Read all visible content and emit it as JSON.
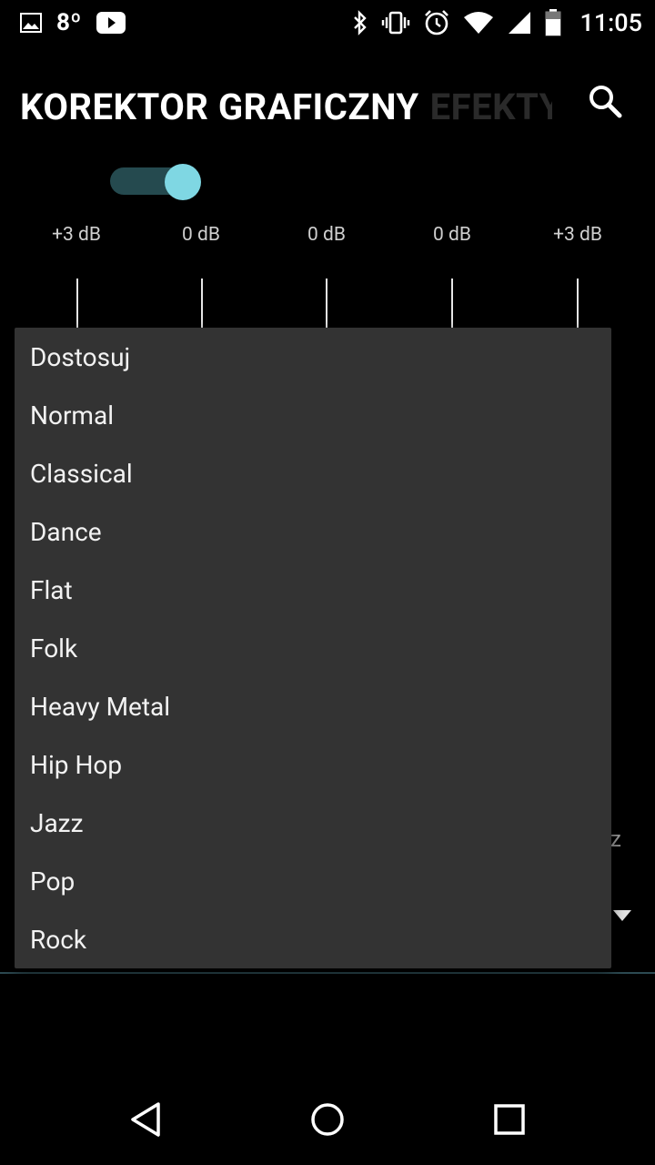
{
  "status_bar": {
    "temperature": "8º",
    "time": "11:05",
    "icons": [
      "image-icon",
      "youtube-icon",
      "bluetooth-icon",
      "vibrate-icon",
      "alarm-icon",
      "wifi-icon",
      "signal-icon",
      "battery-icon"
    ]
  },
  "header": {
    "tab_active": "KOREKTOR GRAFICZNY",
    "tab_inactive": "EFEKTY",
    "search_icon": "search-icon"
  },
  "toggle": {
    "state": "on",
    "accent": "#7fd7e3"
  },
  "eq": {
    "bands": [
      "+3 dB",
      "0 dB",
      "0 dB",
      "0 dB",
      "+3 dB"
    ]
  },
  "background_peek": {
    "partial_text": "z"
  },
  "dropdown": {
    "items": [
      "Dostosuj",
      "Normal",
      "Classical",
      "Dance",
      "Flat",
      "Folk",
      "Heavy Metal",
      "Hip Hop",
      "Jazz",
      "Pop",
      "Rock"
    ]
  },
  "nav": {
    "icons": [
      "back-icon",
      "home-icon",
      "recents-icon"
    ]
  }
}
